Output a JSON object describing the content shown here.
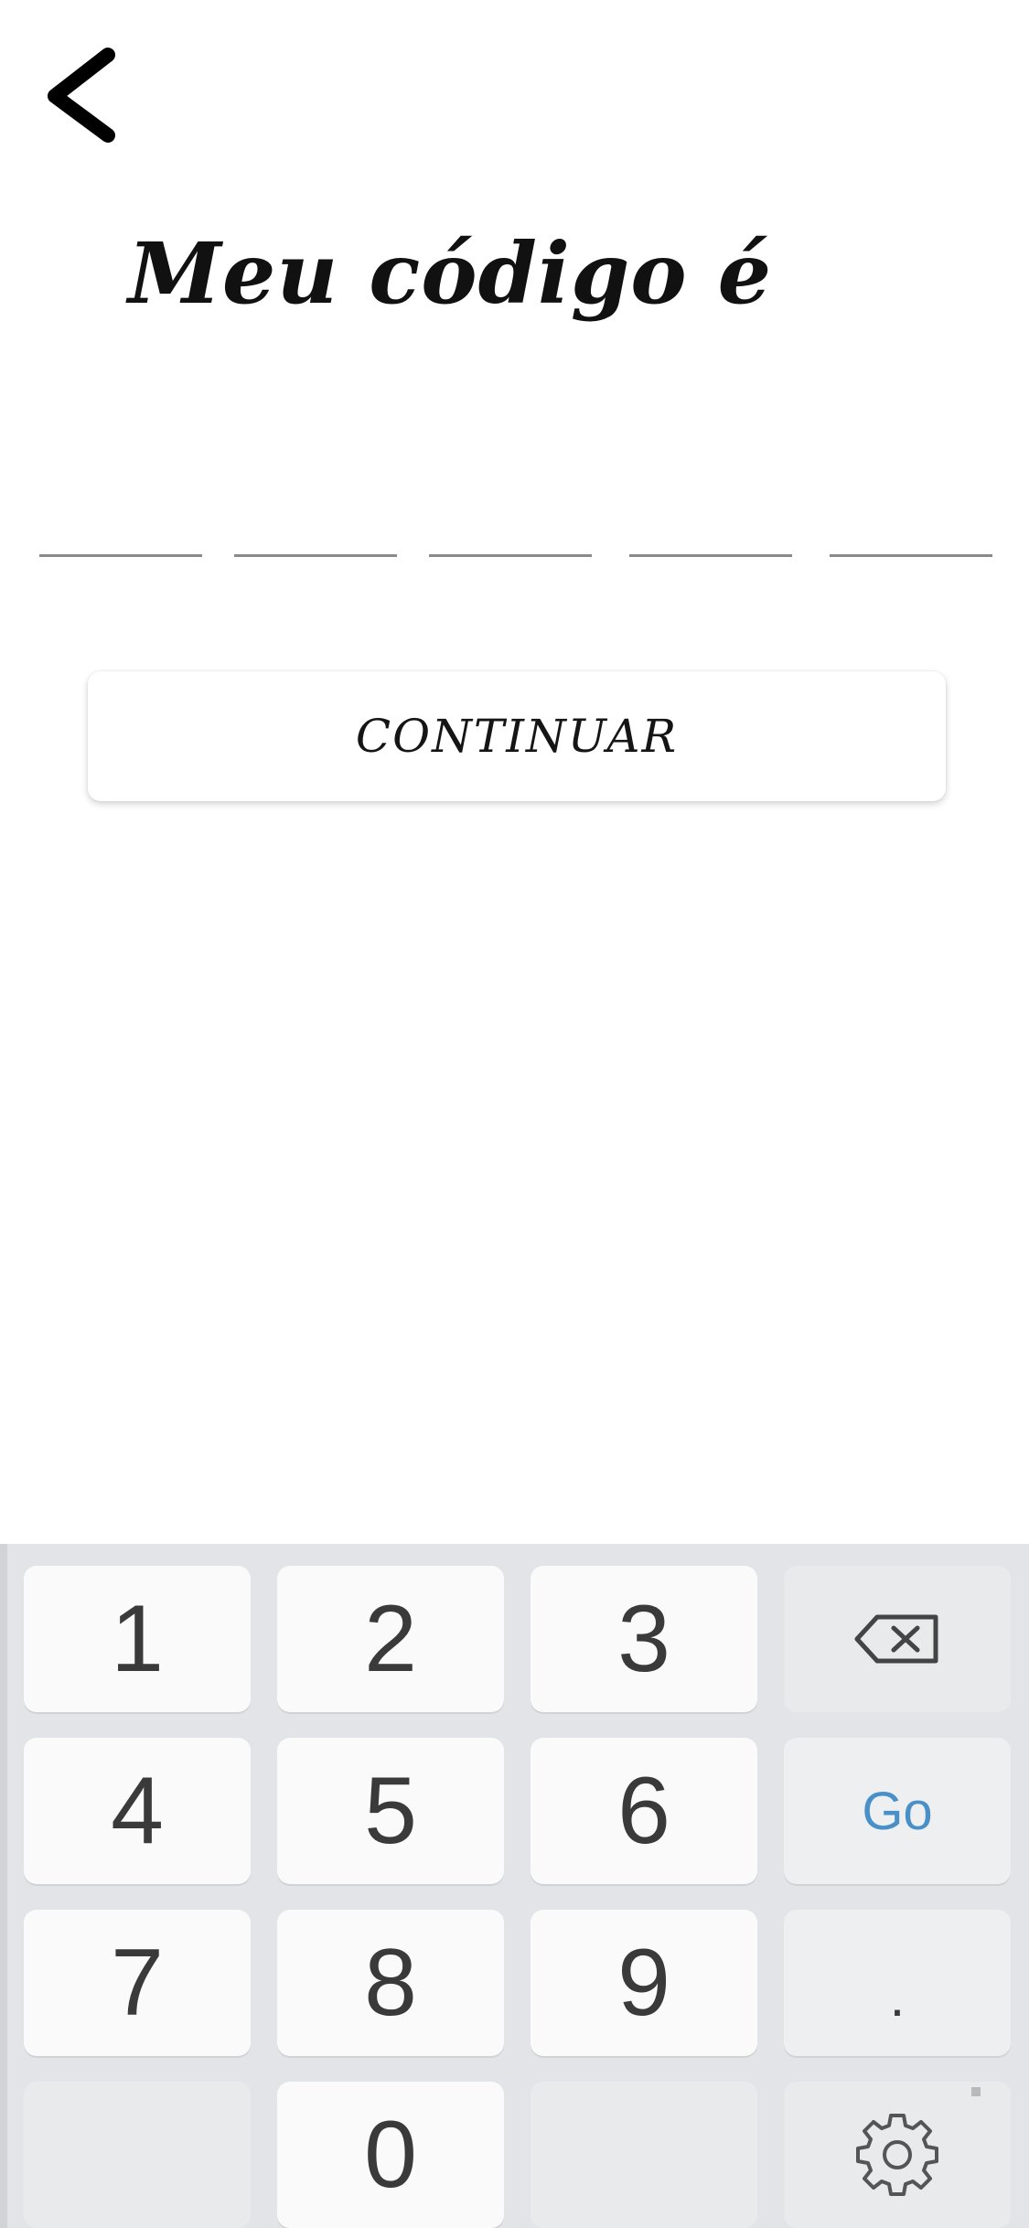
{
  "header": {
    "back_icon": "chevron-left-icon",
    "title": "Meu código é"
  },
  "code_input": {
    "slot_count": 5,
    "values": [
      "",
      "",
      "",
      "",
      ""
    ]
  },
  "continue_button": {
    "label": "CONTINUAR"
  },
  "keyboard": {
    "rows": [
      [
        "1",
        "2",
        "3",
        "backspace-icon"
      ],
      [
        "4",
        "5",
        "6",
        "Go"
      ],
      [
        "7",
        "8",
        "9",
        "."
      ],
      [
        "",
        "0",
        "",
        "gear-icon"
      ]
    ],
    "k1": "1",
    "k2": "2",
    "k3": "3",
    "k4": "4",
    "k5": "5",
    "k6": "6",
    "k7": "7",
    "k8": "8",
    "k9": "9",
    "k0": "0",
    "go_label": "Go",
    "dot_label": ".",
    "accent_color": "#4a90c8"
  }
}
